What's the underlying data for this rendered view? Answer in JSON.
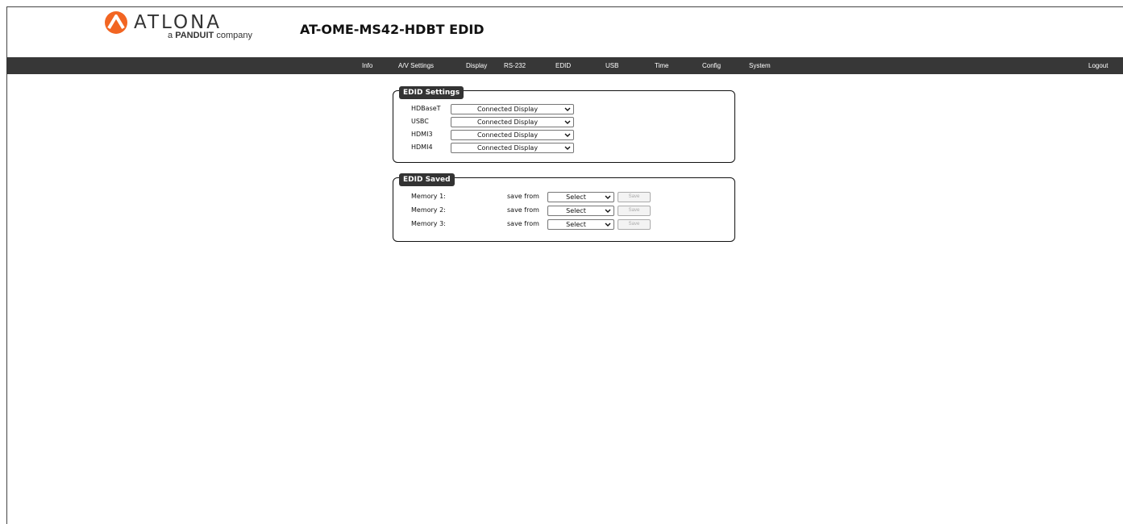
{
  "header": {
    "logo_word": "ATLONA",
    "logo_sub_prefix": "a",
    "logo_sub_brand": "PANDUIT",
    "logo_sub_suffix": "company",
    "page_title": "AT-OME-MS42-HDBT  EDID"
  },
  "nav": {
    "items": [
      "Info",
      "A/V Settings",
      "Display",
      "RS-232",
      "EDID",
      "USB",
      "Time",
      "Config",
      "System"
    ],
    "logout": "Logout"
  },
  "edid_settings": {
    "legend": "EDID Settings",
    "rows": [
      {
        "label": "HDBaseT",
        "value": "Connected Display"
      },
      {
        "label": "USBC",
        "value": "Connected Display"
      },
      {
        "label": "HDMI3",
        "value": "Connected Display"
      },
      {
        "label": "HDMI4",
        "value": "Connected Display"
      }
    ]
  },
  "edid_saved": {
    "legend": "EDID Saved",
    "save_from_label": "save from",
    "rows": [
      {
        "label": "Memory 1:",
        "select": "Select",
        "button": "Save"
      },
      {
        "label": "Memory 2:",
        "select": "Select",
        "button": "Save"
      },
      {
        "label": "Memory 3:",
        "select": "Select",
        "button": "Save"
      }
    ]
  },
  "colors": {
    "navbar": "#373737",
    "logo_orange": "#f26522",
    "legend_bg": "#333333"
  },
  "icons": {
    "logo_mark": "atlona-chevron-logo-icon",
    "dropdown": "chevron-down-icon"
  }
}
